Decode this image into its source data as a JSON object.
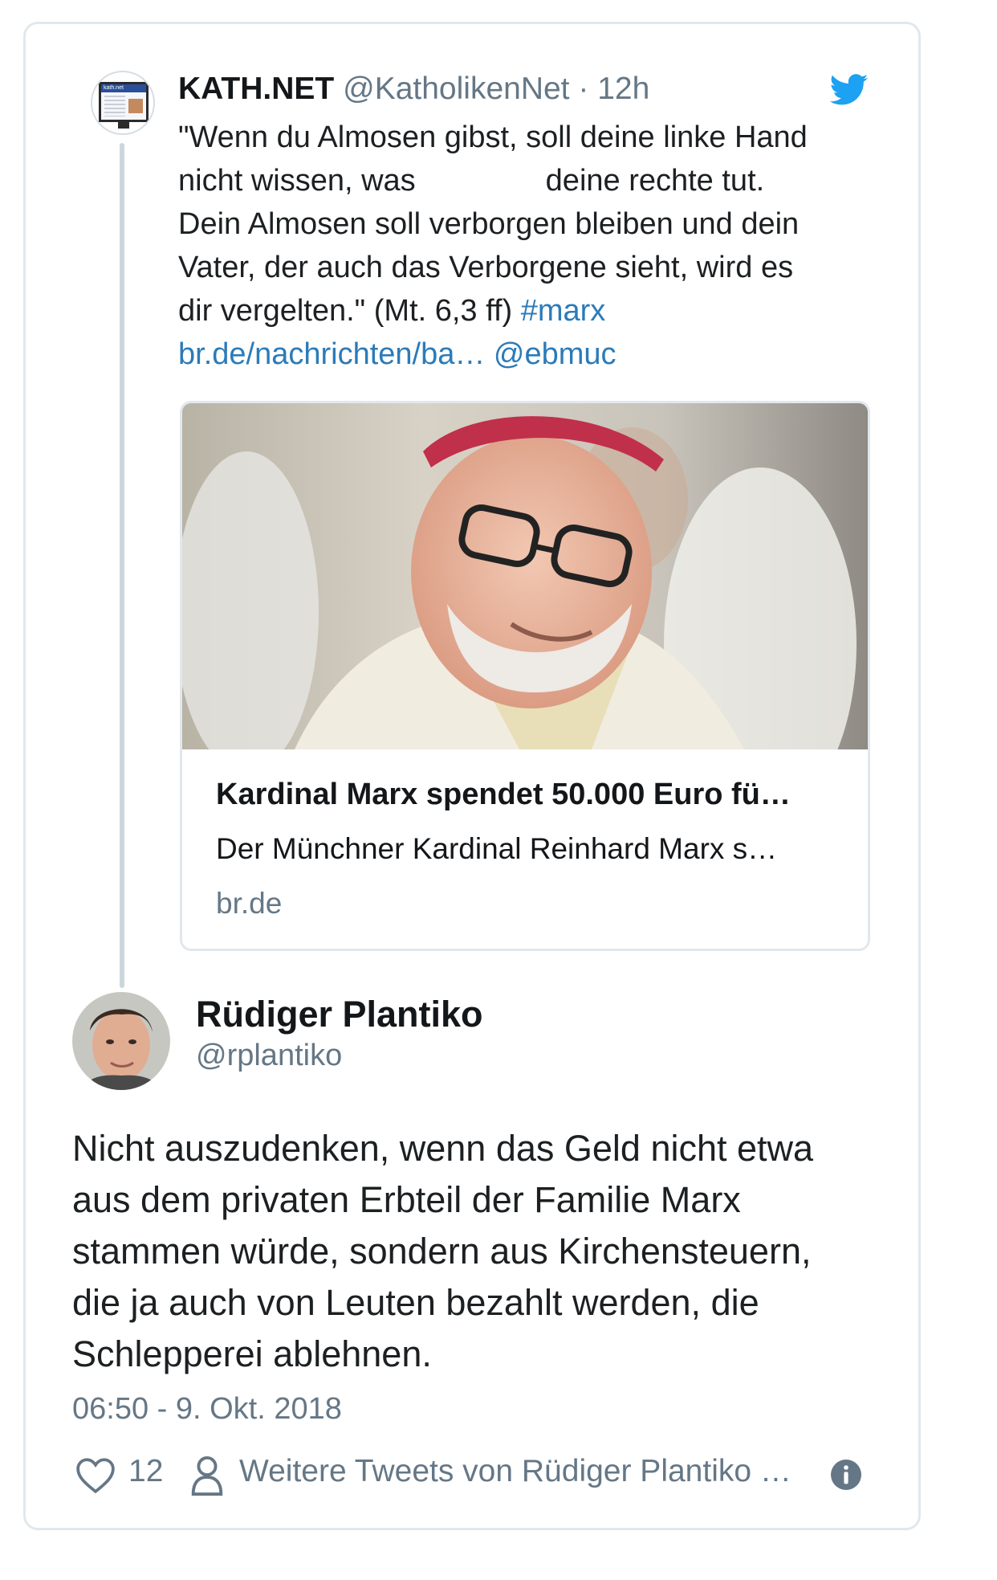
{
  "quoted_tweet": {
    "name": "KATH.NET",
    "handle": "@KatholikenNet",
    "separator": "·",
    "time": "12h",
    "avatar_label": "kath.net",
    "text_lines": [
      "\"Wenn du Almosen gibst, soll deine linke Hand",
      "nicht wissen, was",
      "deine rechte tut.",
      "Dein Almosen soll verborgen bleiben und dein",
      "Vater, der auch das Verborgene sieht, wird es",
      "dir vergelten.\" (Mt. 6,3 ff)"
    ],
    "hashtag": "#marx",
    "url": "br.de/nachrichten/ba…",
    "mention": "@ebmuc",
    "card": {
      "title": "Kardinal Marx spendet 50.000 Euro fü…",
      "description": "Der Münchner Kardinal Reinhard Marx s…",
      "domain": "br.de"
    }
  },
  "reply": {
    "name": "Rüdiger Plantiko",
    "handle": "@rplantiko",
    "text_lines": [
      "Nicht auszudenken, wenn das Geld nicht etwa",
      "aus dem privaten Erbteil der Familie Marx",
      "stammen würde, sondern aus Kirchensteuern,",
      "die ja auch von Leuten bezahlt werden, die",
      "Schlepperei ablehnen."
    ],
    "date": "06:50 - 9. Okt. 2018",
    "likes": "12",
    "more_tweets": "Weitere Tweets von Rüdiger Plantiko …"
  },
  "icons": [
    "twitter-bird-icon",
    "heart-icon",
    "person-icon",
    "info-icon"
  ],
  "colors": {
    "link": "#2b7bb9",
    "twitter_blue": "#1da1f2",
    "secondary_text": "#657786",
    "border": "#e1e8ed"
  }
}
